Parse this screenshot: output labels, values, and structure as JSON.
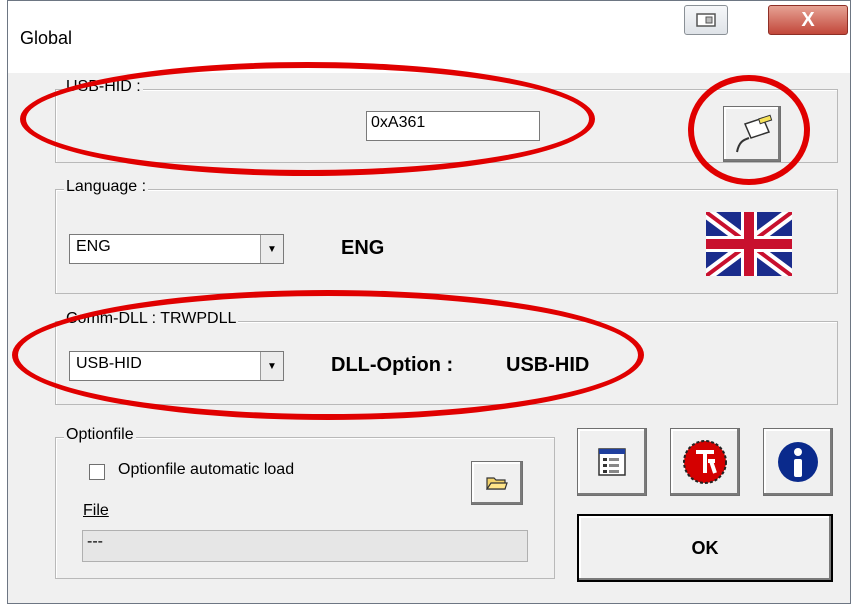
{
  "window": {
    "title": "Global",
    "close_label": "X"
  },
  "usb_hid": {
    "label": "USB-HID :",
    "value": "0xA361"
  },
  "language": {
    "label": "Language :",
    "selected": "ENG",
    "display": "ENG"
  },
  "comm_dll": {
    "label": "Comm-DLL : TRWPDLL",
    "selected": "USB-HID",
    "option_label": "DLL-Option :",
    "option_value": "USB-HID"
  },
  "optionfile": {
    "label": "Optionfile",
    "auto_load_label": "Optionfile automatic load",
    "auto_load_checked": false,
    "file_label": "File",
    "file_value": "---"
  },
  "buttons": {
    "ok_label": "OK"
  },
  "icons": {
    "usb": "usb-plug-icon",
    "flag": "uk-flag-icon",
    "folder": "open-folder-icon",
    "settings": "window-list-icon",
    "logo": "tr-logo-icon",
    "info": "info-icon"
  },
  "colors": {
    "highlight": "#e00000",
    "window_bg": "#f0f0f0"
  }
}
